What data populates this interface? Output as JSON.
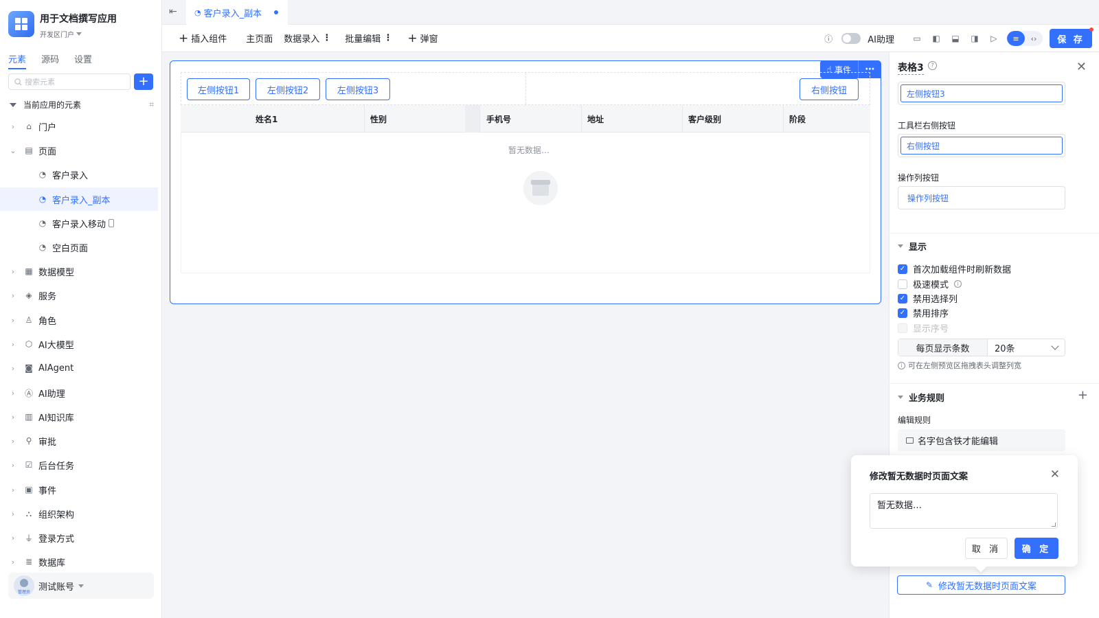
{
  "app": {
    "title": "用于文档撰写应用",
    "workspace": "开发区门户",
    "brand_color": "#3370ff"
  },
  "sidebar": {
    "tabs": [
      {
        "label": "元素"
      },
      {
        "label": "源码"
      },
      {
        "label": "设置"
      }
    ],
    "search_placeholder": "搜索元素",
    "section_title": "当前应用的元素",
    "items": [
      {
        "label": "门户",
        "icon": "home-icon"
      },
      {
        "label": "页面",
        "icon": "page-icon"
      },
      {
        "label": "客户录入",
        "icon": "page-node-icon"
      },
      {
        "label": "客户录入_副本",
        "icon": "page-node-icon"
      },
      {
        "label": "客户录入移动",
        "icon": "page-node-icon"
      },
      {
        "label": "空白页面",
        "icon": "page-node-icon"
      },
      {
        "label": "数据模型",
        "icon": "table-icon"
      },
      {
        "label": "服务",
        "icon": "service-icon"
      },
      {
        "label": "角色",
        "icon": "role-icon"
      },
      {
        "label": "AI大模型",
        "icon": "ai-model-icon"
      },
      {
        "label": "AIAgent",
        "icon": "robot-icon"
      },
      {
        "label": "AI助理",
        "icon": "ai-assistant-icon"
      },
      {
        "label": "AI知识库",
        "icon": "book-icon"
      },
      {
        "label": "审批",
        "icon": "stamp-icon"
      },
      {
        "label": "后台任务",
        "icon": "task-icon"
      },
      {
        "label": "事件",
        "icon": "event-icon"
      },
      {
        "label": "组织架构",
        "icon": "org-icon"
      },
      {
        "label": "登录方式",
        "icon": "login-icon"
      },
      {
        "label": "数据库",
        "icon": "database-icon"
      }
    ],
    "user": {
      "name": "测试账号",
      "role_tag": "管理员"
    }
  },
  "tabbar": {
    "tab_label": "客户录入_副本"
  },
  "toolbar": {
    "insert": "插入组件",
    "home": "主页面",
    "data_entry": "数据录入",
    "batch_edit": "批量编辑",
    "popup": "弹窗",
    "ai_assistant": "AI助理",
    "save": "保 存"
  },
  "canvas": {
    "event_label": "事件",
    "left_buttons": [
      "左侧按钮1",
      "左侧按钮2",
      "左侧按钮3"
    ],
    "right_button": "右侧按钮",
    "columns": [
      "姓名1",
      "性别",
      "手机号",
      "地址",
      "客户级别",
      "阶段"
    ],
    "empty_text": "暂无数据…"
  },
  "panel": {
    "title": "表格3",
    "left_btn_value": "左侧按钮3",
    "right_btn_label": "工具栏右侧按钮",
    "right_btn_value": "右侧按钮",
    "op_btn_label": "操作列按钮",
    "op_btn_value": "操作列按钮",
    "display_section": "显示",
    "options": [
      {
        "label": "首次加载组件时刷新数据",
        "checked": true
      },
      {
        "label": "极速模式",
        "checked": false
      },
      {
        "label": "禁用选择列",
        "checked": true
      },
      {
        "label": "禁用排序",
        "checked": true
      },
      {
        "label": "显示序号",
        "checked": false,
        "disabled": true
      }
    ],
    "page_size_label": "每页显示条数",
    "page_size_value": "20条",
    "hint": "可在左侧预览区拖拽表头调整列宽",
    "rules_section": "业务规则",
    "edit_rule_label": "编辑规则",
    "rule_item": "名字包含铁才能编辑",
    "edit_empty_btn": "修改暂无数据时页面文案"
  },
  "popover": {
    "title": "修改暂无数据时页面文案",
    "text_value": "暂无数据…",
    "cancel": "取 消",
    "ok": "确 定"
  }
}
